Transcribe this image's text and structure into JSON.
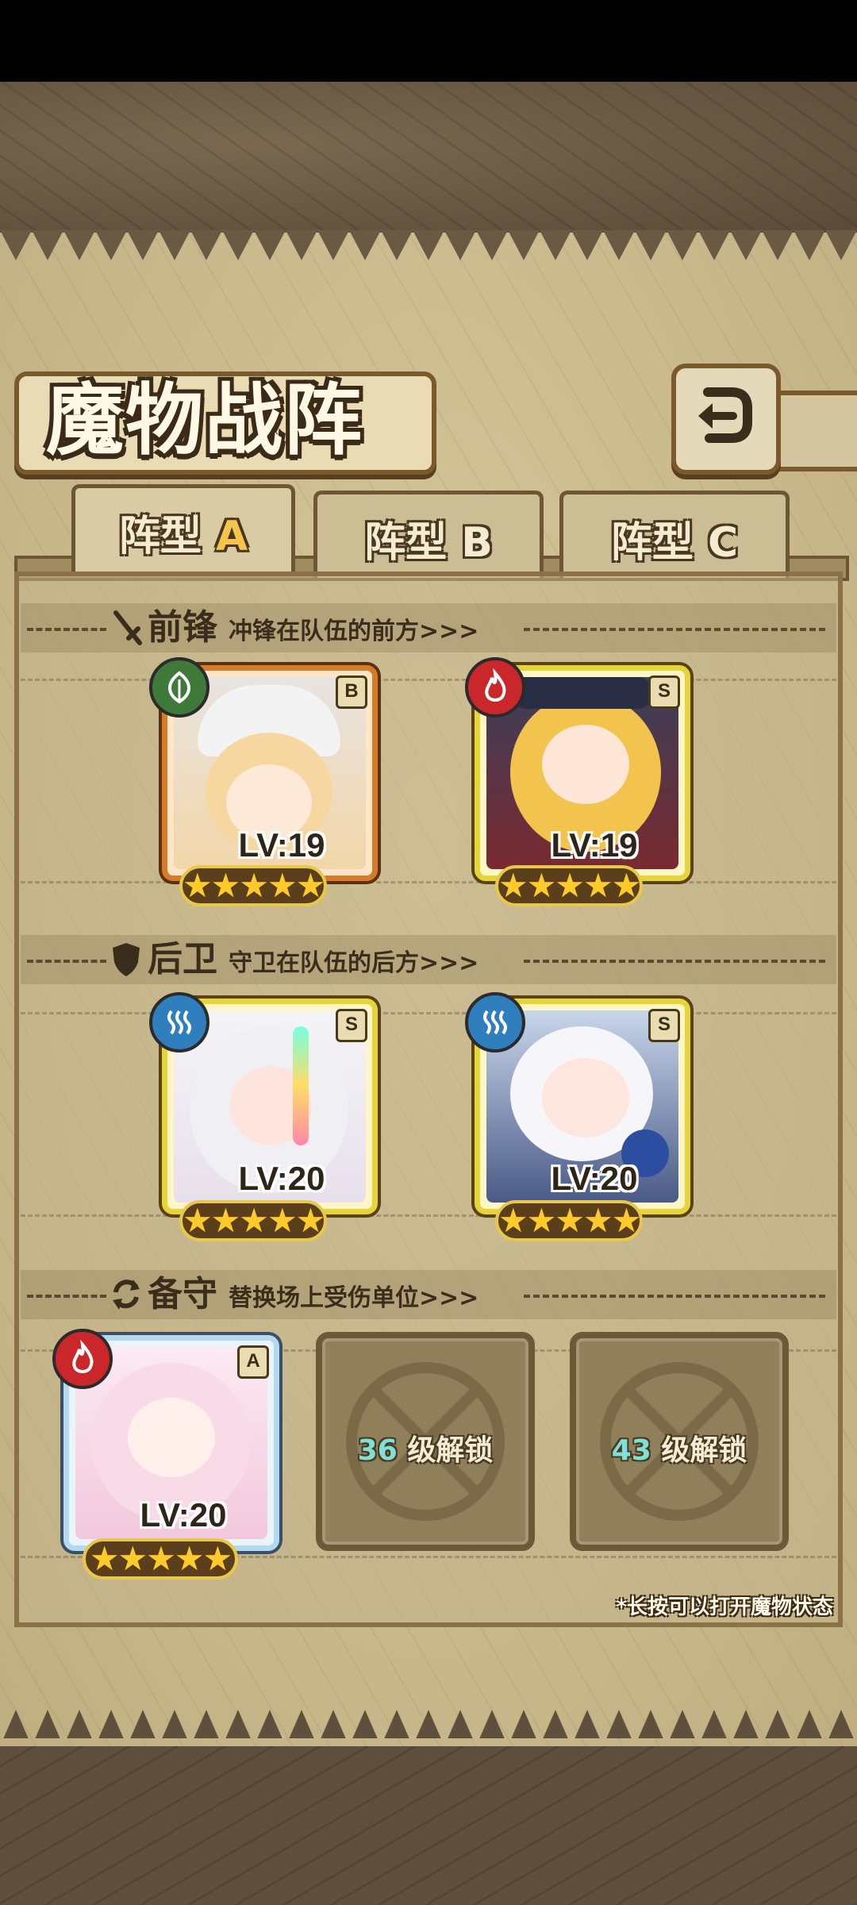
{
  "screen_title": "魔物战阵",
  "tabs": [
    {
      "prefix": "阵型",
      "letter": "A",
      "active": true
    },
    {
      "prefix": "阵型",
      "letter": "B",
      "active": false
    },
    {
      "prefix": "阵型",
      "letter": "C",
      "active": false
    }
  ],
  "sections": {
    "vanguard": {
      "title": "前锋",
      "desc": "冲锋在队伍的前方>>>"
    },
    "rearguard": {
      "title": "后卫",
      "desc": "守卫在队伍的后方>>>"
    },
    "reserve": {
      "title": "备守",
      "desc": "替换场上受伤单位>>>"
    }
  },
  "units": {
    "vanguard_1": {
      "level": "LV:19",
      "rank": "B",
      "element": "leaf",
      "stars": "★★★★★"
    },
    "vanguard_2": {
      "level": "LV:19",
      "rank": "S",
      "element": "fire",
      "stars": "★★★★★"
    },
    "rearguard_1": {
      "level": "LV:20",
      "rank": "S",
      "element": "water",
      "stars": "★★★★★"
    },
    "rearguard_2": {
      "level": "LV:20",
      "rank": "S",
      "element": "water",
      "stars": "★★★★★"
    },
    "reserve_1": {
      "level": "LV:20",
      "rank": "A",
      "element": "fire",
      "stars": "★★★★★"
    }
  },
  "locked_slots": [
    {
      "level": "36",
      "text": "级解锁"
    },
    {
      "level": "43",
      "text": "级解锁"
    }
  ],
  "hint": "*长按可以打开魔物状态",
  "colors": {
    "parchment": "#cdbf93",
    "frame": "#7a5a2c",
    "star": "#ffcb2a",
    "unlock_number": "#7fe0d8"
  }
}
